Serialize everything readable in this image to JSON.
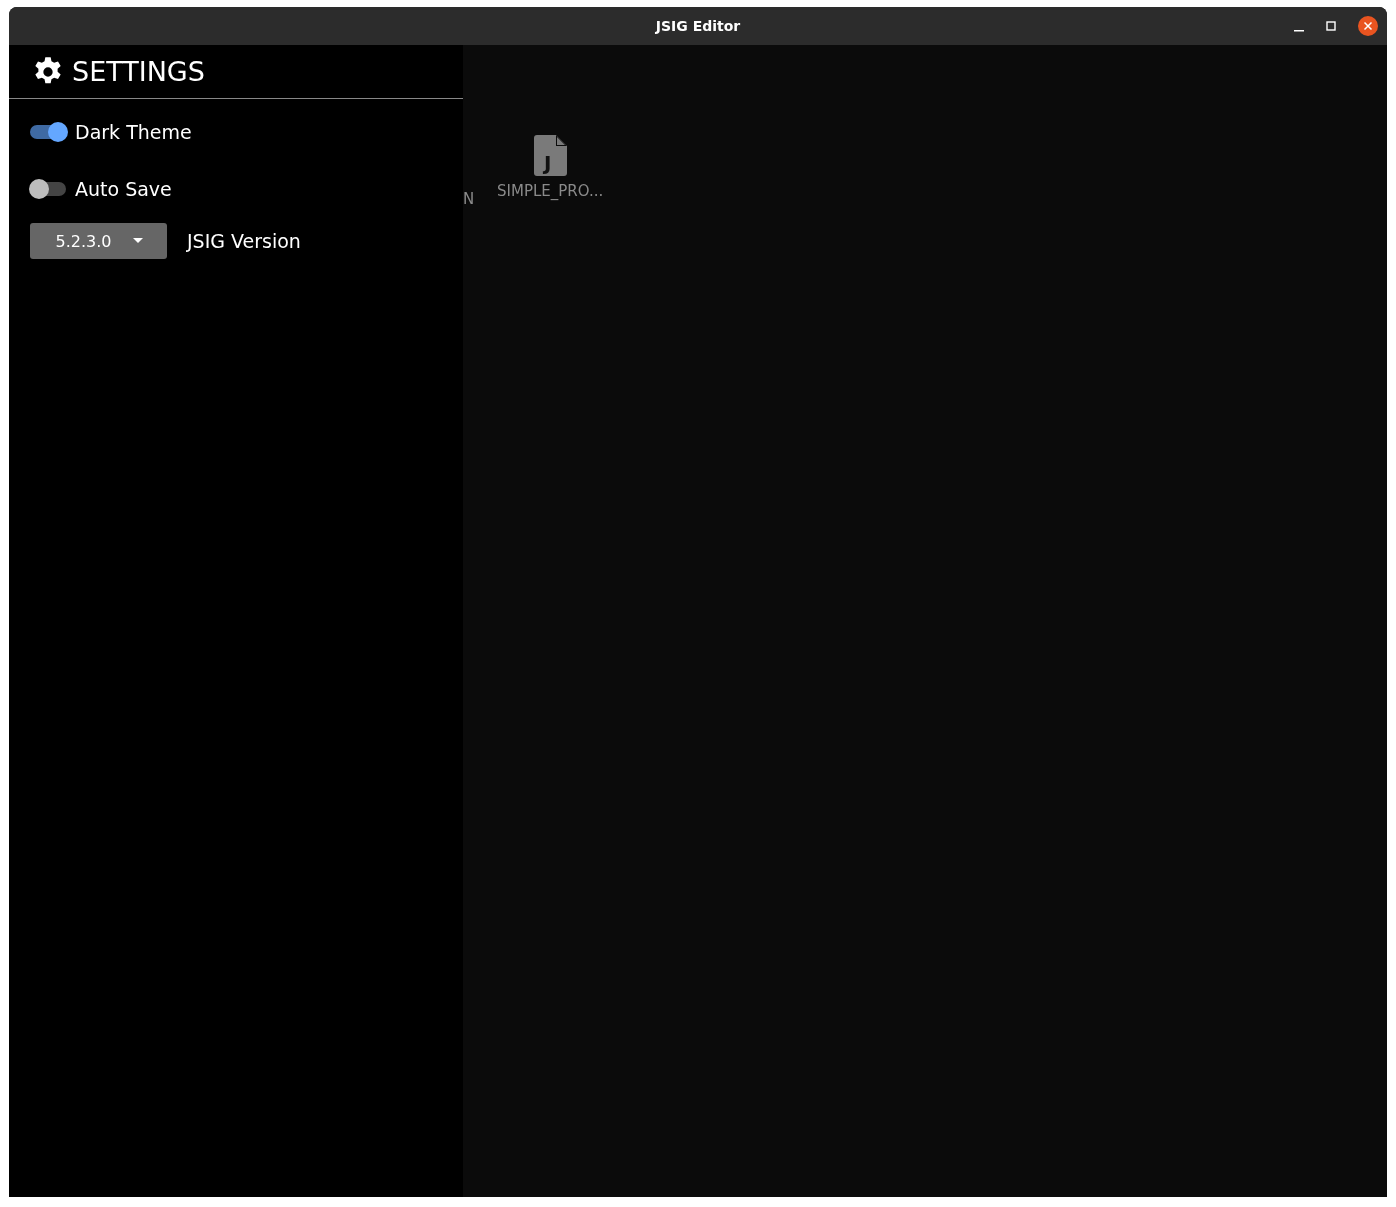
{
  "window": {
    "title": "JSIG Editor"
  },
  "settings": {
    "title": "SETTINGS",
    "toggles": [
      {
        "label": "Dark Theme",
        "on": true
      },
      {
        "label": "Auto Save",
        "on": false
      }
    ],
    "version": {
      "value": "5.2.3.0",
      "label": "JSIG Version"
    }
  },
  "main": {
    "edge_text": "N",
    "files": [
      {
        "icon_letter": "J",
        "name": "SIMPLE_PRO..."
      }
    ]
  }
}
